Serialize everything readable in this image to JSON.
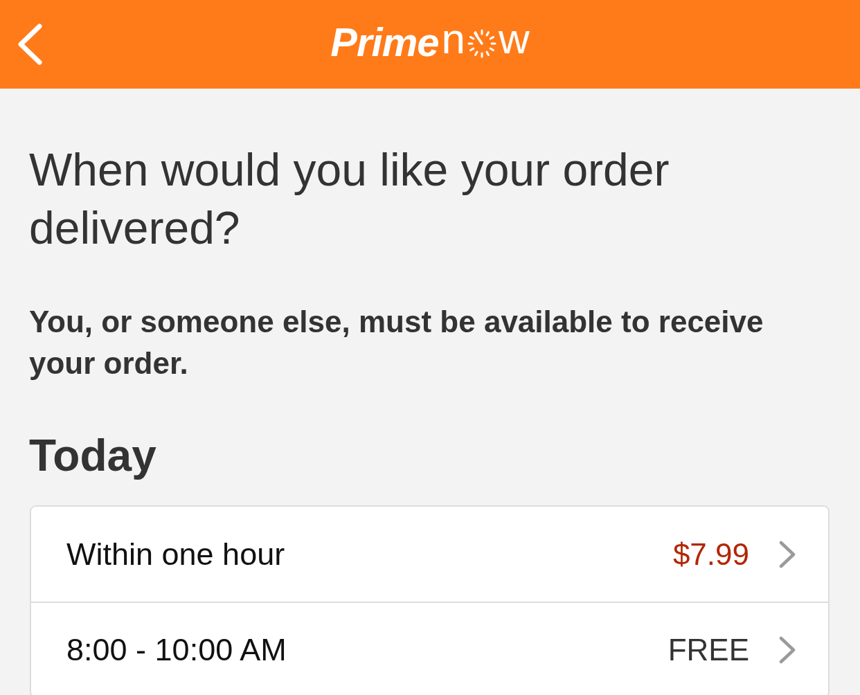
{
  "header": {
    "logo": {
      "prime": "Prime",
      "now_start": "n",
      "now_end": "w"
    }
  },
  "question": "When would you like your order delivered?",
  "notice": "You, or someone else, must be available to receive your order.",
  "sections": [
    {
      "title": "Today",
      "options": [
        {
          "label": "Within one hour",
          "price": "$7.99",
          "kind": "paid"
        },
        {
          "label": "8:00 - 10:00 AM",
          "price": "FREE",
          "kind": "free"
        }
      ]
    }
  ]
}
